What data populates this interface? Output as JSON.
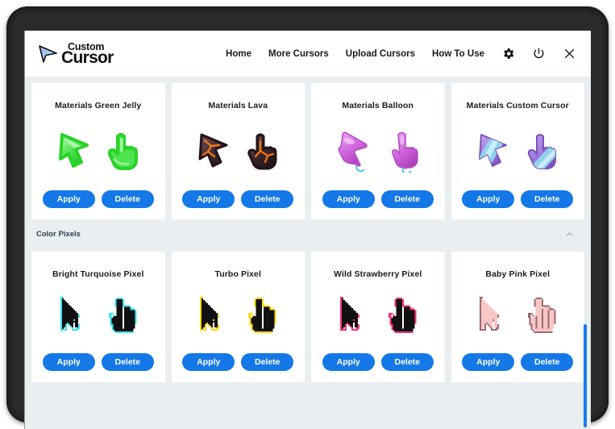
{
  "header": {
    "brand": {
      "icon": "cursor-arrow-logo",
      "line1": "Custom",
      "line2": "Cursor"
    },
    "nav": [
      {
        "label": "Home",
        "name": "nav-home"
      },
      {
        "label": "More Cursors",
        "name": "nav-more-cursors"
      },
      {
        "label": "Upload Cursors",
        "name": "nav-upload-cursors"
      },
      {
        "label": "How To Use",
        "name": "nav-how-to-use"
      }
    ],
    "icons": [
      {
        "name": "gear-icon",
        "label": "Settings"
      },
      {
        "name": "power-icon",
        "label": "Power"
      },
      {
        "name": "close-icon",
        "label": "Close"
      }
    ]
  },
  "buttons": {
    "apply": "Apply",
    "delete": "Delete"
  },
  "sections": [
    {
      "name": "materials-section",
      "title": null,
      "cards": [
        {
          "title": "Materials Green Jelly",
          "style": "jelly",
          "color": "#3ddc3d",
          "light": "#a8f5a8",
          "dark": "#1fb81f"
        },
        {
          "title": "Materials Lava",
          "style": "jelly",
          "color": "#4a3238",
          "light": "#6b4a4a",
          "dark": "#2a1a20",
          "accent": "#ff6a00"
        },
        {
          "title": "Materials Balloon",
          "style": "jelly",
          "color": "#cb5fd8",
          "light": "#e89cf0",
          "dark": "#a93cb8",
          "accent": "#46c8ea"
        },
        {
          "title": "Materials Custom Cursor",
          "style": "jelly",
          "color": "#9f74dd",
          "light": "#c0a3ec",
          "dark": "#7a52b8",
          "accent": "#7fd4ec"
        }
      ]
    },
    {
      "name": "color-pixels-section",
      "title": "Color Pixels",
      "collapse_icon": "chevron-up-icon",
      "cards": [
        {
          "title": "Bright Turquoise Pixel",
          "style": "pixel",
          "fill": "#111111",
          "outline": "#36e6f0"
        },
        {
          "title": "Turbo Pixel",
          "style": "pixel",
          "fill": "#111111",
          "outline": "#ffd800"
        },
        {
          "title": "Wild Strawberry Pixel",
          "style": "pixel",
          "fill": "#111111",
          "outline": "#ff2f7d"
        },
        {
          "title": "Baby Pink Pixel",
          "style": "pixel",
          "fill": "#f9c6c6",
          "outline": "#9c6a6f"
        }
      ]
    }
  ],
  "scrollbar": {
    "name": "vertical-scrollbar",
    "color": "#1a7ce8"
  },
  "theme": {
    "accent": "#1478e8",
    "content_bg": "#e9eff1",
    "card_bg": "#ffffff",
    "bezel": "#1c1c1c"
  }
}
